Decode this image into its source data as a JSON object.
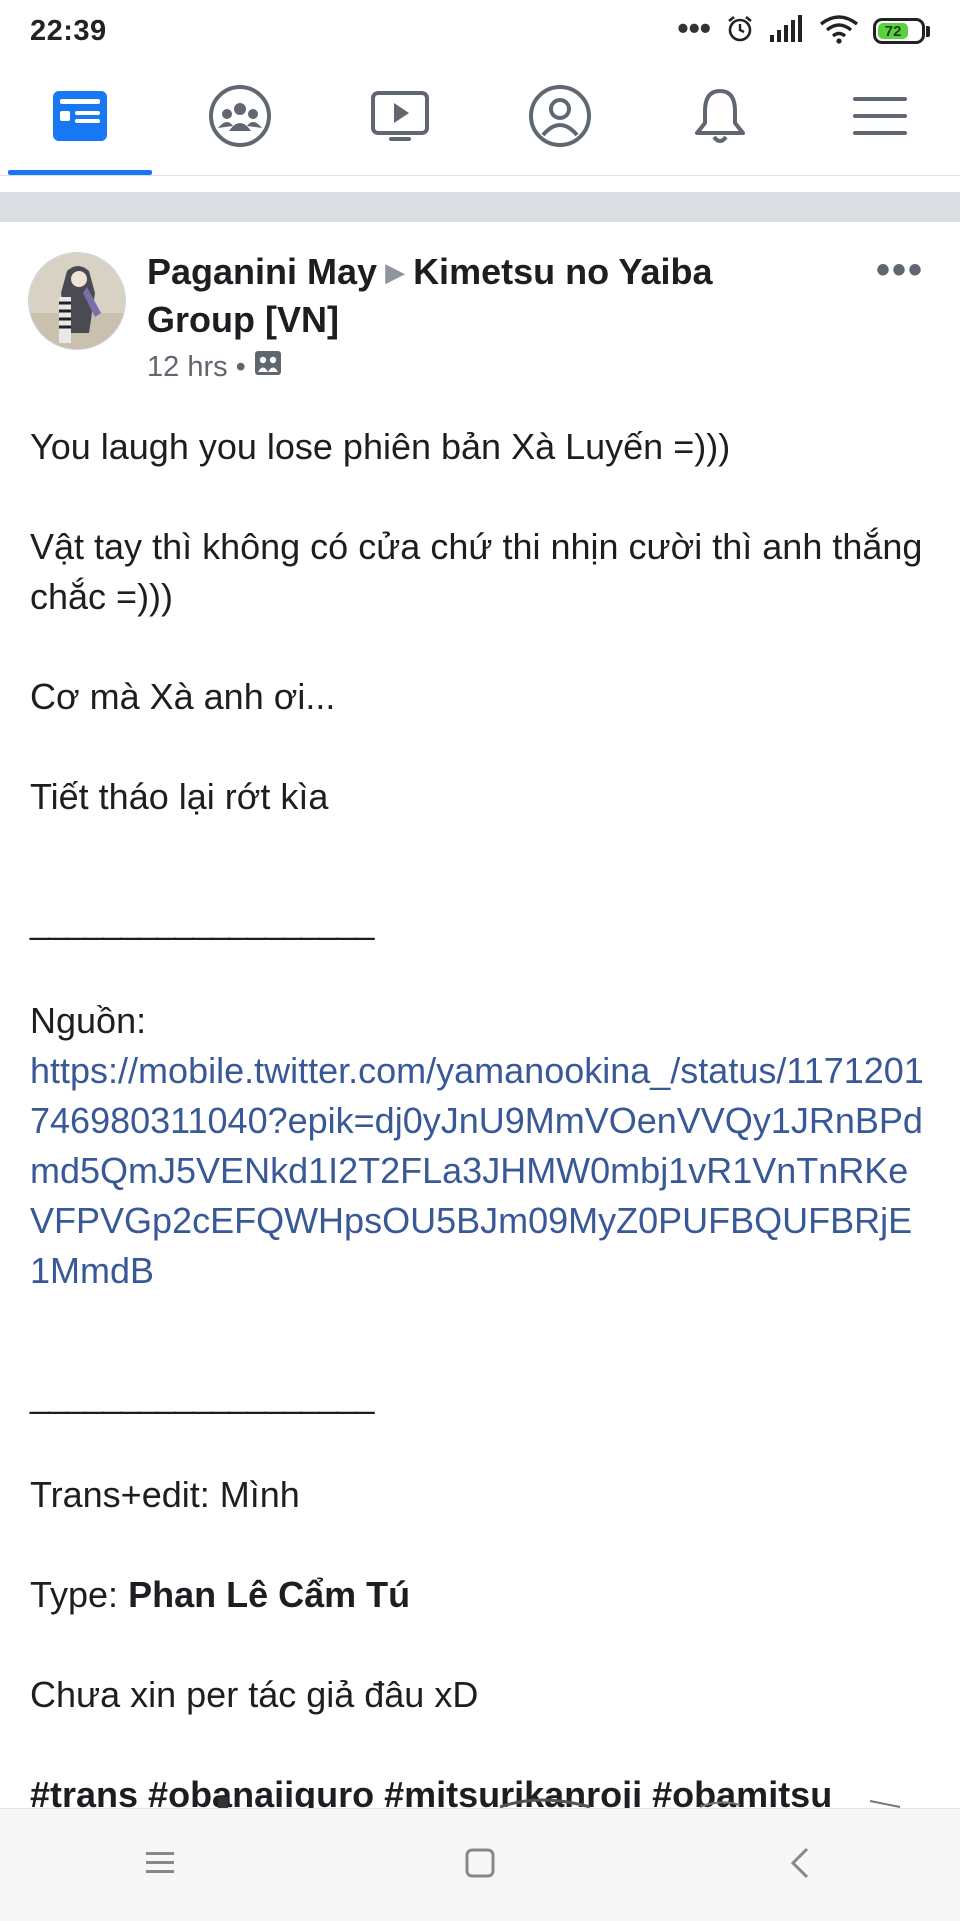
{
  "status_bar": {
    "time": "22:39",
    "dots": "•••",
    "battery_level": "72",
    "icons": [
      "alarm-icon",
      "signal-icon",
      "wifi-icon",
      "battery-icon"
    ]
  },
  "tabs": [
    {
      "name": "news-feed",
      "icon": "news-feed-icon",
      "active": true
    },
    {
      "name": "groups",
      "icon": "groups-icon",
      "active": false
    },
    {
      "name": "watch",
      "icon": "watch-video-icon",
      "active": false
    },
    {
      "name": "profile",
      "icon": "profile-icon",
      "active": false
    },
    {
      "name": "notifications",
      "icon": "bell-icon",
      "active": false
    },
    {
      "name": "menu",
      "icon": "hamburger-menu-icon",
      "active": false
    }
  ],
  "colors": {
    "accent": "#1877f2",
    "link": "#385898",
    "divider": "#dadde1",
    "battery": "#5ad13f"
  },
  "post": {
    "author": "Paganini May",
    "group": "Kimetsu no Yaiba Group [VN]",
    "time": "12 hrs",
    "meta_separator": "•",
    "privacy_icon": "group-audience-icon",
    "more": "•••",
    "body": {
      "line1": "You laugh you lose phiên bản Xà Luyến =)))",
      "line2": "Vật tay thì không có cửa chứ thi nhịn cười thì anh thắng chắc =)))",
      "line3": "Cơ mà Xà anh ơi...",
      "line4": "Tiết tháo lại rớt kìa",
      "rule1": "___________________",
      "source_label": "Nguồn:",
      "source_url": "https://mobile.twitter.com/yamanookina_/status/1171201746980311040?epik=dj0yJnU9MmVOenVVQy1JRnBPdmd5QmJ5VENkd1I2T2FLa3JHMW0mbj1vR1VnTnRKeVFPVGp2cEFQWHpsOU5BJm09MyZ0PUFBQUFBRjE1MmdB",
      "rule2": "___________________",
      "trans": "Trans+edit: Mình",
      "type_label": "Type:",
      "type_name": "Phan Lê Cẩm Tú",
      "note": "Chưa xin per tác giả đâu xD",
      "hashtags": "#trans #obanaiiguro #mitsurikanroji #obamitsu"
    }
  },
  "system_nav": [
    "recents-icon",
    "home-icon",
    "back-icon"
  ]
}
